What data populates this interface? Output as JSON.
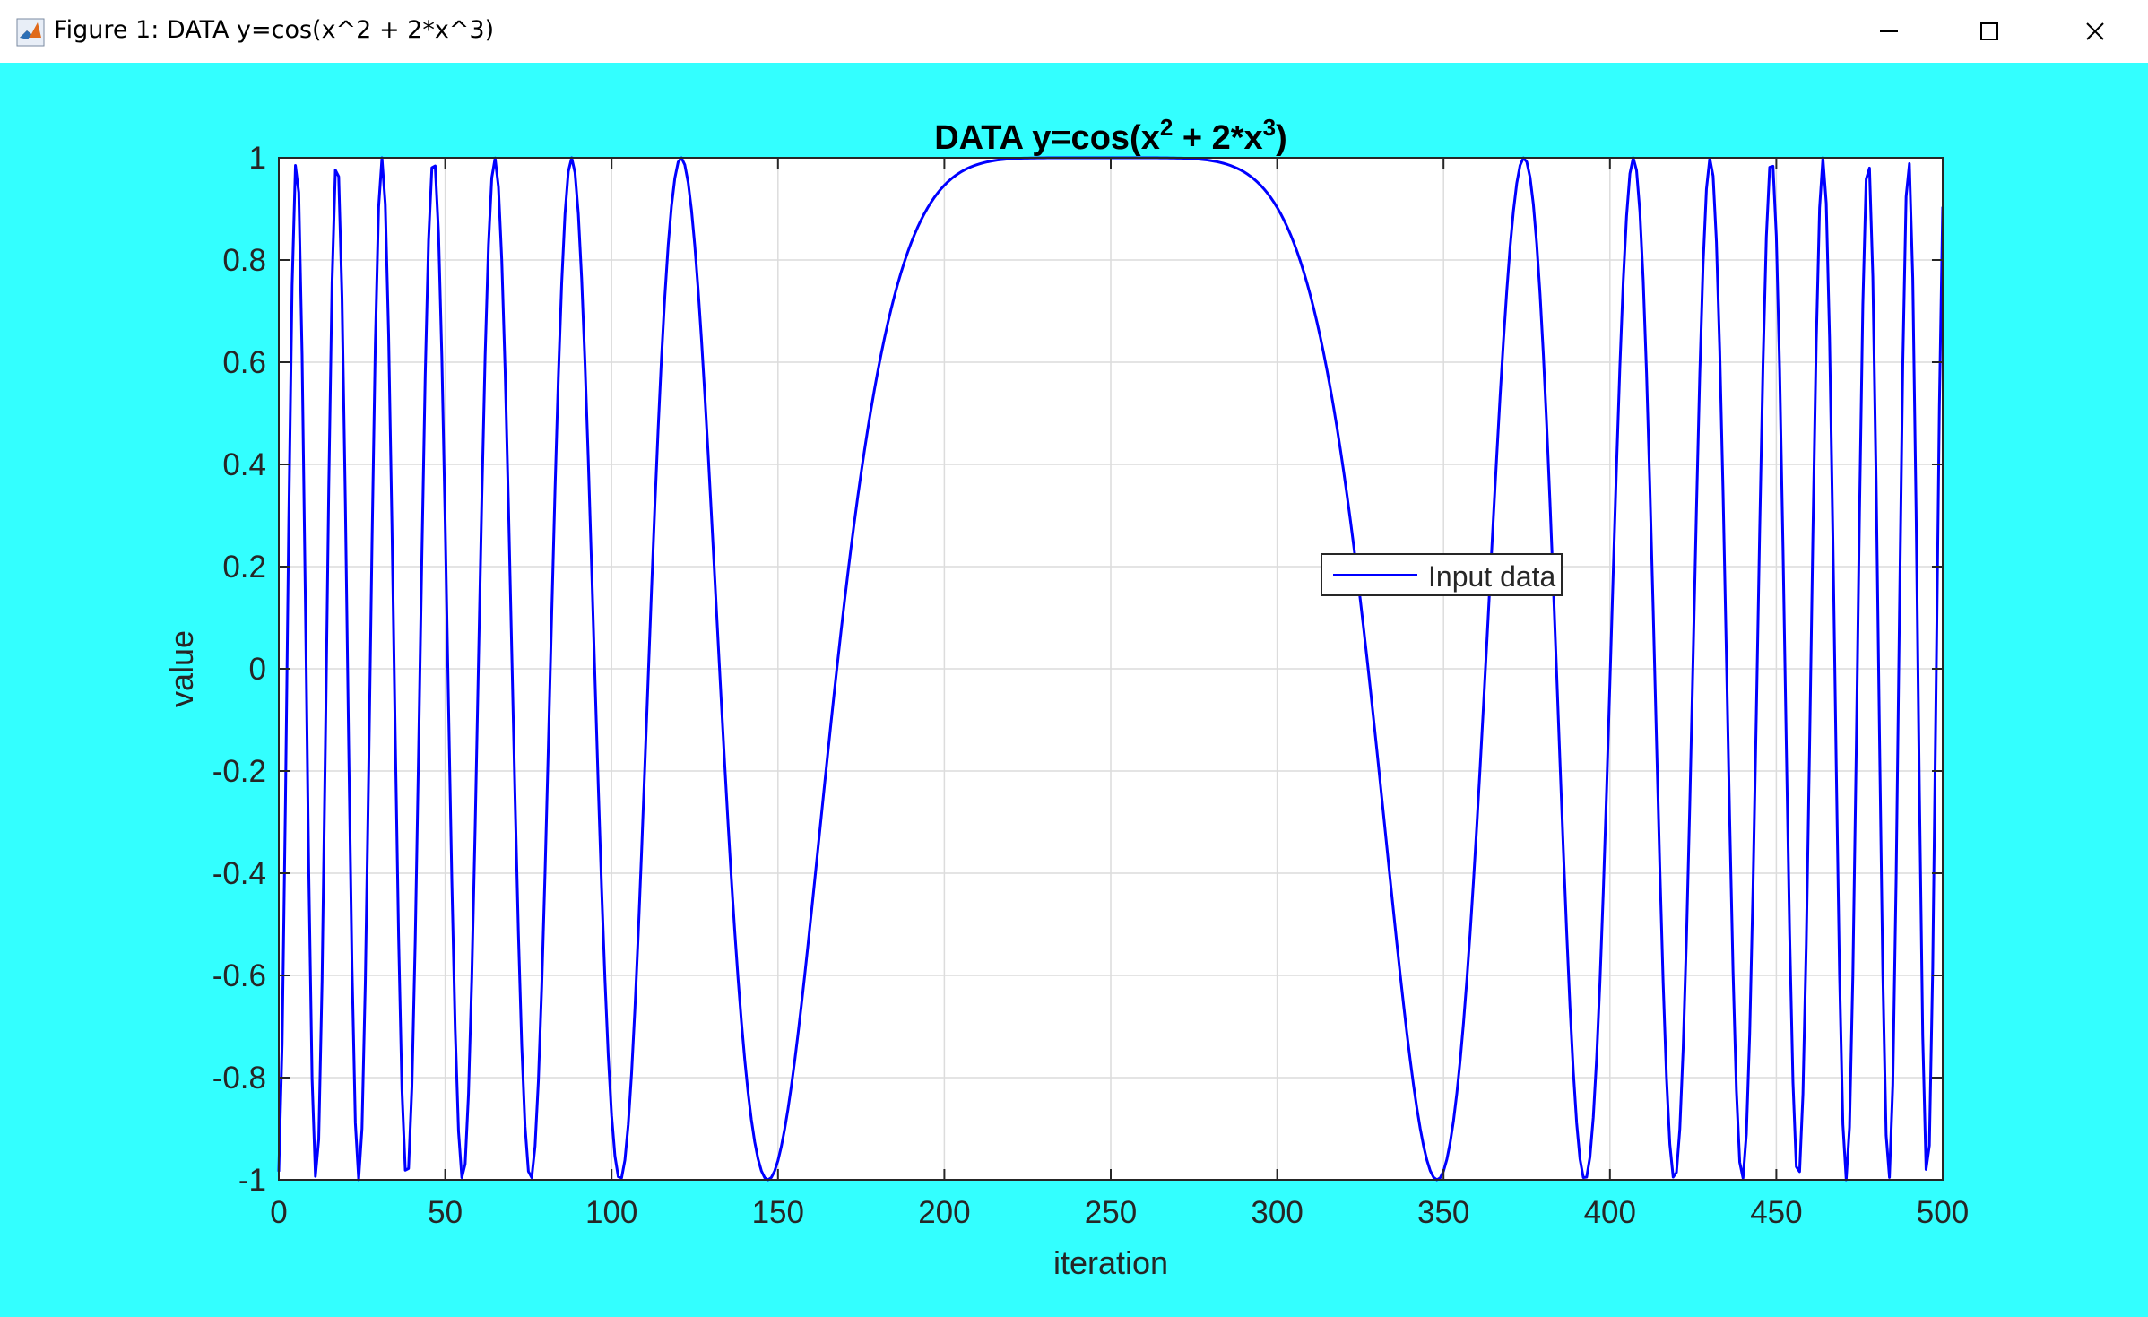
{
  "window": {
    "title": "Figure 1: DATA y=cos(x^2 + 2*x^3)",
    "app_icon": "matlab-icon",
    "buttons": [
      "minimize-icon",
      "maximize-icon",
      "close-icon"
    ]
  },
  "colors": {
    "figure_background": "#33ffff",
    "axes_background": "#ffffff",
    "line": "#0000ff",
    "grid": "#dcdcdc",
    "axis": "#262626"
  },
  "chart_data": {
    "type": "line",
    "title": {
      "base": "DATA y=cos(x",
      "sup1": "2",
      "mid": " + 2*x",
      "sup2": "3",
      "end": ")"
    },
    "xlabel": "iteration",
    "ylabel": "value",
    "xlim": [
      0,
      500
    ],
    "ylim": [
      -1,
      1
    ],
    "xticks": [
      "0",
      "50",
      "100",
      "150",
      "200",
      "250",
      "300",
      "350",
      "400",
      "450",
      "500"
    ],
    "yticks": [
      "1",
      "0.8",
      "0.6",
      "0.4",
      "0.2",
      "0",
      "-0.2",
      "-0.4",
      "-0.6",
      "-0.8",
      "-1"
    ],
    "grid": true,
    "legend_position": "center-right",
    "series": [
      {
        "name": "Input data",
        "formula": "y = cos(x^2 + 2*x^3)",
        "x_range": [
          0,
          500
        ],
        "points": 501
      }
    ]
  }
}
